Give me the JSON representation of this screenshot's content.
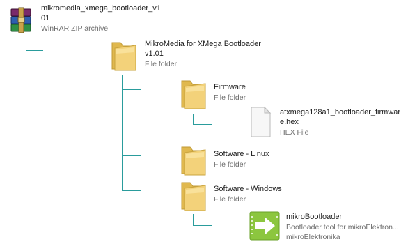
{
  "root": {
    "name_line1": "mikromedia_xmega_bootloader_v1",
    "name_line2": "01",
    "type": "WinRAR ZIP archive",
    "icon": "winrar-archive-icon"
  },
  "folder_main": {
    "name_line1": "MikroMedia for XMega Bootloader",
    "name_line2": "v1.01",
    "type": "File folder",
    "icon": "folder-icon"
  },
  "folder_firmware": {
    "name": "Firmware",
    "type": "File folder",
    "icon": "folder-icon"
  },
  "file_hex": {
    "name_line1": "atxmega128a1_bootloader_firmwar",
    "name_line2": "e.hex",
    "type": "HEX File",
    "icon": "document-icon"
  },
  "folder_linux": {
    "name": "Software - Linux",
    "type": "File folder",
    "icon": "folder-icon"
  },
  "folder_windows": {
    "name": "Software - Windows",
    "type": "File folder",
    "icon": "folder-icon"
  },
  "app_bootloader": {
    "name": "mikroBootloader",
    "description": "Bootloader tool for mikroElektron...",
    "company": "mikroElektronika",
    "icon": "mikrobootloader-arrow-icon"
  },
  "colors": {
    "tree_line": "#2a9c9c",
    "folder": "#f2cf6e",
    "app_green": "#8cc63f"
  }
}
